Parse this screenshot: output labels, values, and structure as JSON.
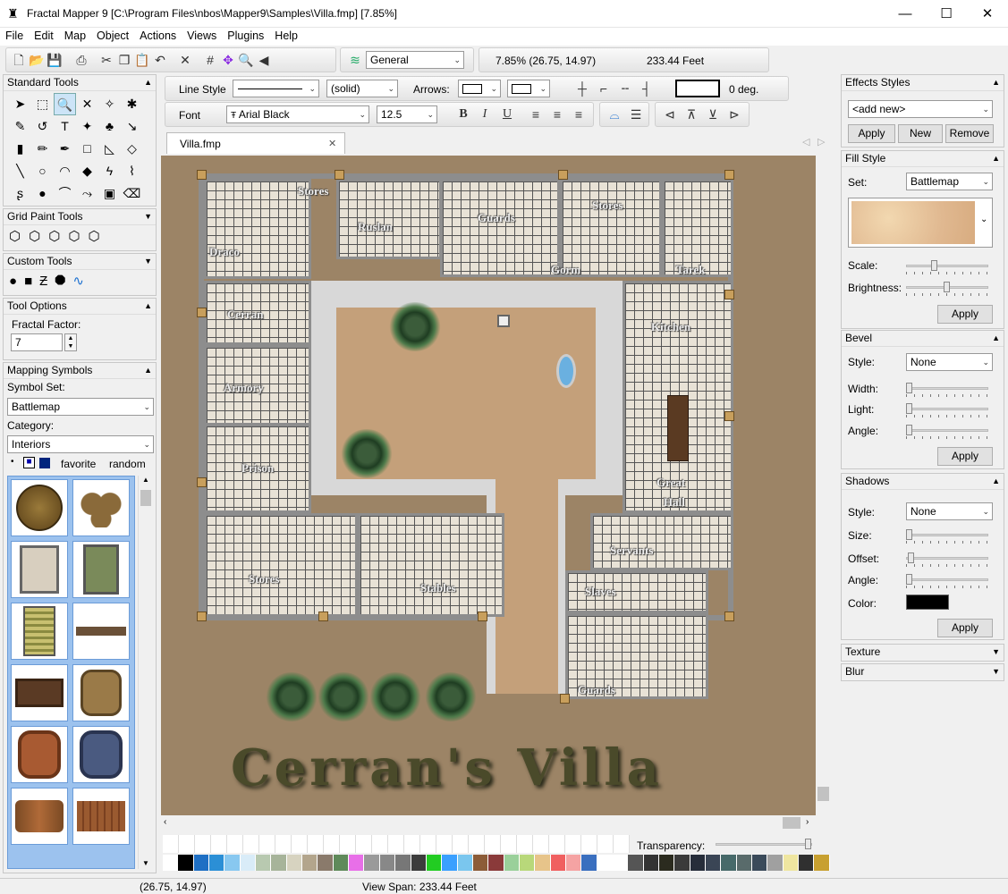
{
  "window": {
    "title": "Fractal Mapper 9 [C:\\Program Files\\nbos\\Mapper9\\Samples\\Villa.fmp] [7.85%]",
    "min": "—",
    "max": "☐",
    "close": "✕"
  },
  "menu": [
    "File",
    "Edit",
    "Map",
    "Object",
    "Actions",
    "Views",
    "Plugins",
    "Help"
  ],
  "toolbar": {
    "layer": "General",
    "zoom_readout": "7.85%  (26.75, 14.97)",
    "span_readout": "233.44 Feet"
  },
  "line": {
    "label": "Line Style",
    "pattern": "(solid)",
    "arrows_label": "Arrows:",
    "angle": "0 deg."
  },
  "font": {
    "label": "Font",
    "name": "Arial Black",
    "size": "12.5",
    "bold": "B",
    "italic": "I",
    "underline": "U"
  },
  "tab": {
    "name": "Villa.fmp",
    "close": "✕"
  },
  "left": {
    "standard_tools": "Standard Tools",
    "grid_paint_tools": "Grid Paint Tools",
    "custom_tools": "Custom Tools",
    "tool_options": "Tool Options",
    "fractal_factor_label": "Fractal Factor:",
    "fractal_factor": "7",
    "mapping_symbols": "Mapping Symbols",
    "symbol_set_label": "Symbol Set:",
    "symbol_set": "Battlemap",
    "category_label": "Category:",
    "category": "Interiors",
    "favorite": "favorite",
    "random": "random"
  },
  "right": {
    "effects_styles": "Effects Styles",
    "add_new": "<add new>",
    "apply": "Apply",
    "new": "New",
    "remove": "Remove",
    "fill_style": "Fill Style",
    "set_label": "Set:",
    "set": "Battlemap",
    "scale": "Scale:",
    "brightness": "Brightness:",
    "bevel": "Bevel",
    "style_label": "Style:",
    "bevel_style": "None",
    "width": "Width:",
    "light": "Light:",
    "angle": "Angle:",
    "shadows": "Shadows",
    "shadow_style": "None",
    "size": "Size:",
    "offset": "Offset:",
    "color": "Color:",
    "texture": "Texture",
    "blur": "Blur"
  },
  "map": {
    "title": "Cerran's Villa",
    "rooms": [
      "Stores",
      "Ruslan",
      "Guards",
      "Stores",
      "Draco",
      "Gorm",
      "Tarek",
      "Cerran",
      "Kitchen",
      "Armory",
      "Prison",
      "Great",
      "Hall",
      "Servants",
      "Stores",
      "Stables",
      "Slaves",
      "Guards"
    ]
  },
  "bottom": {
    "transparency": "Transparency:"
  },
  "status": {
    "coords": "(26.75, 14.97)",
    "span": "View Span: 233.44 Feet"
  },
  "palette": [
    "#ffffff",
    "#000000",
    "#1e6fc4",
    "#2b8fd6",
    "#88c8f0",
    "#d9ecf8",
    "#b8c9b0",
    "#a7b49a",
    "#d7d3c0",
    "#b3a58c",
    "#8a7a6b",
    "#5f8a5a",
    "#e86fe8",
    "#9a9a9a",
    "#888888",
    "#777777",
    "#3c3c3c",
    "#22cc22",
    "#3aa0ff",
    "#7ac6ee",
    "#8c5c38",
    "#8a3a3a",
    "#9ad09a",
    "#b8d87a",
    "#e7c48a",
    "#f06060",
    "#f5a3a3",
    "#3a6fbf",
    "#ffffff",
    "#ffffff",
    "#555555",
    "#333333",
    "#2b2b1f",
    "#3a3a3a",
    "#262d3a",
    "#3a4555",
    "#476a6a",
    "#596b6b",
    "#3a4a5a",
    "#a0a0a0",
    "#efe6a0",
    "#303030",
    "#c8a030"
  ]
}
